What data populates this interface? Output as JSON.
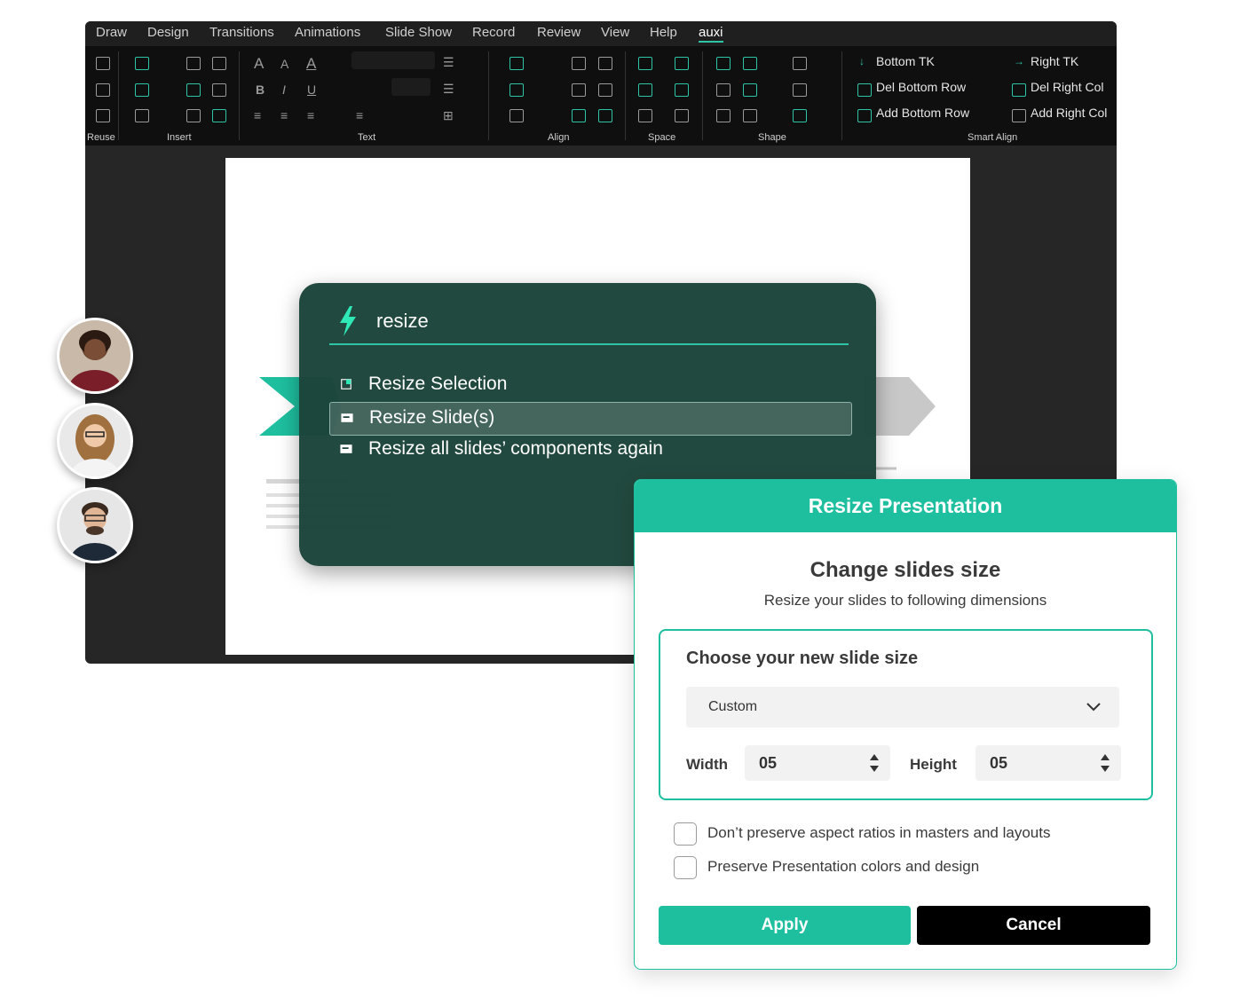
{
  "menu": {
    "items": [
      "Draw",
      "Design",
      "Transitions",
      "Animations",
      "Slide Show",
      "Record",
      "Review",
      "View",
      "Help"
    ],
    "active": "auxi"
  },
  "ribbon": {
    "groups": [
      "Reuse",
      "Insert",
      "Text",
      "Align",
      "Space",
      "Shape",
      "Smart Align"
    ],
    "smart_align": {
      "bottom_tk": "Bottom TK",
      "del_bottom_row": "Del Bottom Row",
      "add_bottom_row": "Add Bottom Row",
      "right_tk": "Right TK",
      "del_right_col": "Del Right Col",
      "add_right_col": "Add Right Col"
    }
  },
  "command_palette": {
    "query": "resize",
    "results": [
      "Resize Selection",
      "Resize Slide(s)",
      "Resize all slides’ components again"
    ],
    "selected_index": 1
  },
  "dialog": {
    "header": "Resize Presentation",
    "title": "Change slides size",
    "subtitle": "Resize your slides to following dimensions",
    "box_label": "Choose your new slide size",
    "size_select": "Custom",
    "width_label": "Width",
    "width_value": "05",
    "height_label": "Height",
    "height_value": "05",
    "options": [
      {
        "label": "Don’t preserve aspect ratios in masters and layouts",
        "checked": false
      },
      {
        "label": "Preserve Presentation colors and design",
        "checked": false
      }
    ],
    "apply_label": "Apply",
    "cancel_label": "Cancel"
  },
  "colors": {
    "accent": "#1ebf9f",
    "palette_bg": "#1b4339",
    "ribbon_bg": "#0f0f0f"
  },
  "avatars": [
    "avatar-1",
    "avatar-2",
    "avatar-3"
  ]
}
